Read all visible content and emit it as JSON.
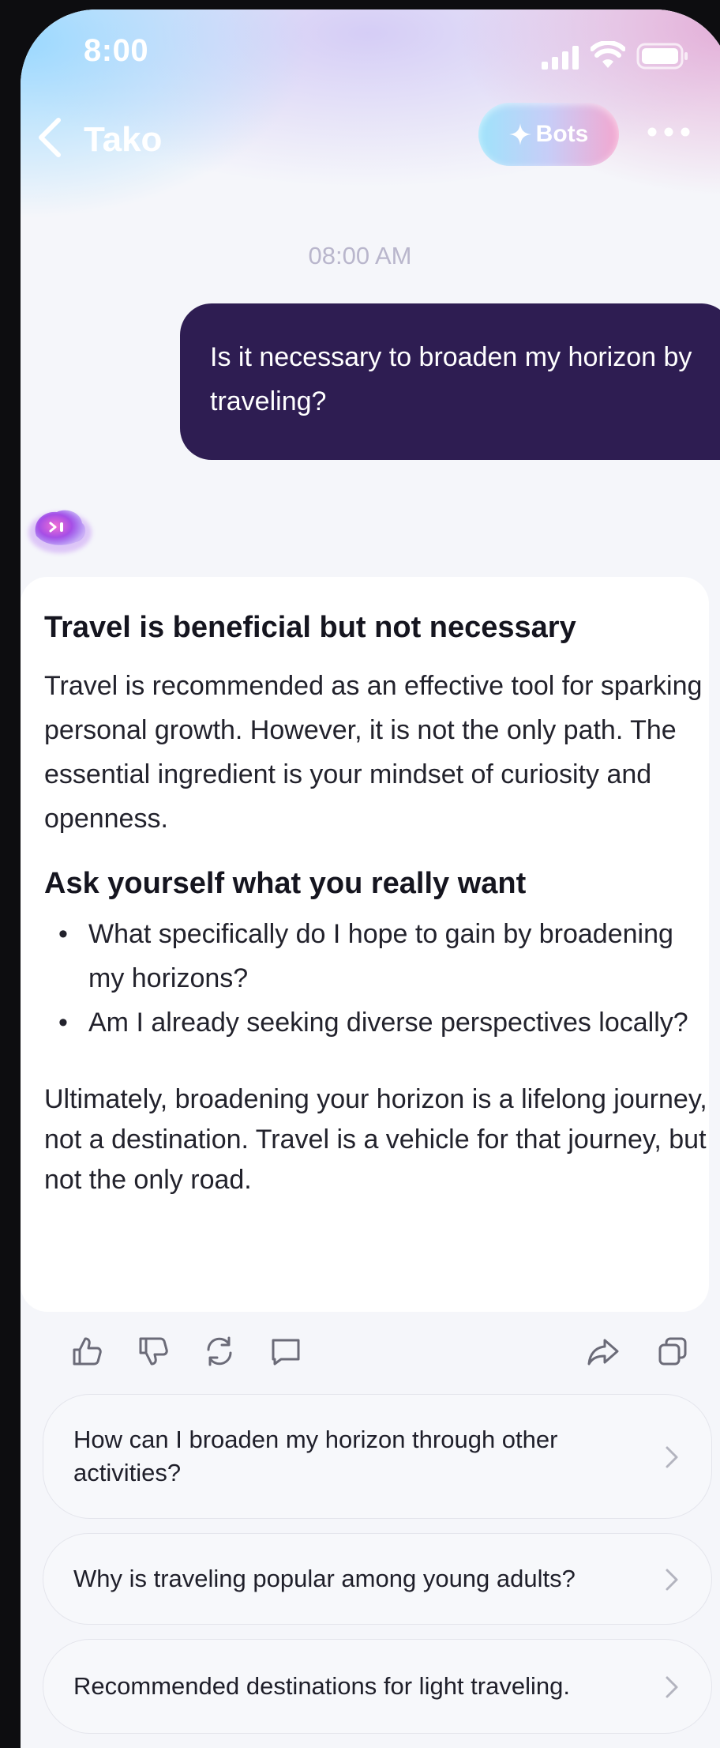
{
  "status_bar": {
    "time": "8:00"
  },
  "header": {
    "title": "Tako",
    "bots_label": "Bots"
  },
  "chat": {
    "timestamp": "08:00 AM",
    "user_message": "Is it necessary to broaden my horizon by traveling?",
    "reply": {
      "heading1": "Travel is beneficial but not necessary",
      "paragraph1": "Travel is recommended as an effective tool for sparking personal growth. However, it is not the only path. The essential ingredient is your mindset of curiosity and openness.",
      "heading2": "Ask yourself what you really want",
      "bullets": [
        "What specifically do I hope to gain by broadening my horizons?",
        "Am I already seeking diverse perspectives locally?"
      ],
      "paragraph2": "Ultimately, broadening your horizon is a lifelong journey, not a destination. Travel is a vehicle for that journey, but not the only road."
    }
  },
  "actions": [
    "thumbs-up-icon",
    "thumbs-down-icon",
    "regenerate-icon",
    "comment-icon",
    "share-icon",
    "copy-icon"
  ],
  "suggestions": [
    "How can I broaden my horizon through other activities?",
    "Why is traveling popular among young adults?",
    "Recommended destinations for light traveling."
  ],
  "colors": {
    "user_bubble": "#2e1d52",
    "background": "#f5f6fa",
    "icon_gray": "#6b6b78"
  }
}
